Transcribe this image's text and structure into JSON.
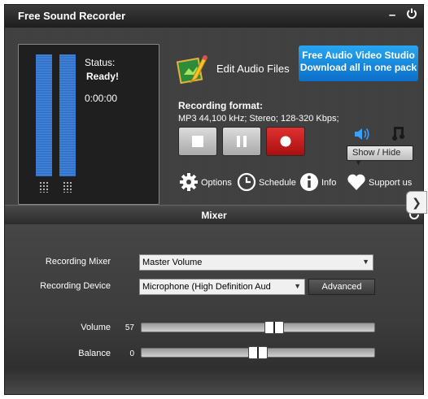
{
  "window": {
    "title": "Free Sound Recorder"
  },
  "status": {
    "label": "Status:",
    "value": "Ready!",
    "time": "0:00:00"
  },
  "edit_audio": {
    "label": "Edit Audio Files"
  },
  "promo": {
    "line1": "Free Audio Video Studio",
    "line2": "Download all in one pack"
  },
  "recording_format": {
    "label": "Recording format:",
    "value": "MP3 44,100 kHz; Stereo;  128-320 Kbps;"
  },
  "show_hide": {
    "label": "Show / Hide",
    "arrow": "▼"
  },
  "toolbar": {
    "options": "Options",
    "schedule": "Schedule",
    "info": "Info",
    "support": "Support us"
  },
  "mixer": {
    "title": "Mixer",
    "recording_mixer_label": "Recording Mixer",
    "recording_mixer_value": "Master Volume",
    "recording_device_label": "Recording Device",
    "recording_device_value": "Microphone (High Definition Aud",
    "advanced_label": "Advanced",
    "volume_label": "Volume",
    "volume_value": "57",
    "balance_label": "Balance",
    "balance_value": "0",
    "volume_level": 0.57,
    "balance_level": 0.5
  },
  "colors": {
    "accent_blue": "#2f6ec4",
    "promo_blue": "#1e90e8",
    "record_red": "#c41e1e"
  }
}
